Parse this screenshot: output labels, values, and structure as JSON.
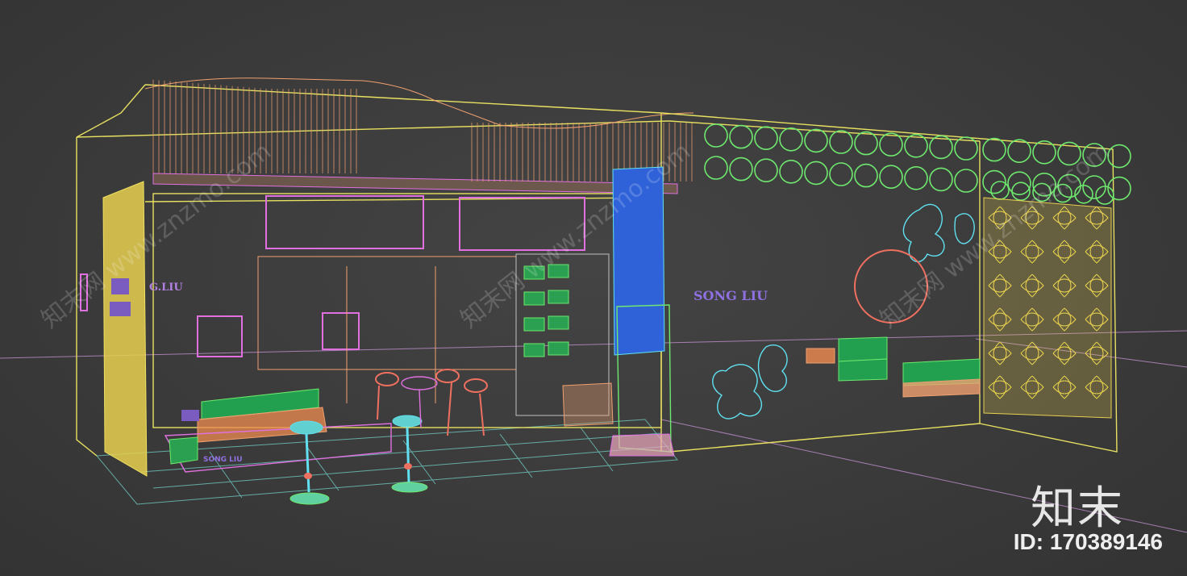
{
  "watermark": {
    "brand": "知末",
    "id_text": "ID: 170389146",
    "faint_texts": [
      "知末网 www.znzmo.com",
      "知末网 www.znzmo.com",
      "知末网 www.znzmo.com"
    ]
  },
  "signage": {
    "left_panel": "G.LIU",
    "right_panel": "SONG LIU",
    "sofa_label": "SONG LIU"
  },
  "colors": {
    "background": "#3a3a3a",
    "ground_grid": "#7fd0c8",
    "yellow": "#f0e060",
    "green": "#6ee86e",
    "magenta": "#e070e0",
    "orange": "#f0a070",
    "cyan": "#60e0f0",
    "blue": "#3a6ae0",
    "solid_green": "#22a050",
    "solid_yellow": "#e8d050"
  }
}
